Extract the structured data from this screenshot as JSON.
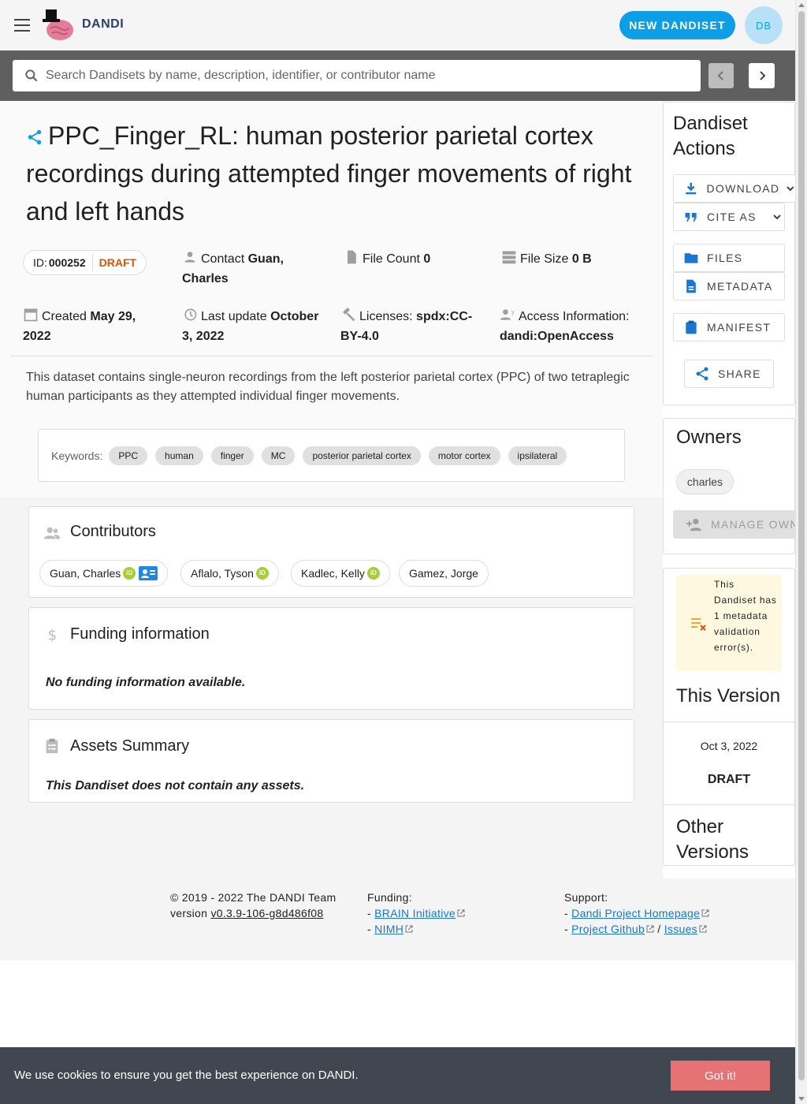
{
  "app": {
    "brand": "DANDI",
    "new_button": "NEW DANDISET",
    "avatar_initials": "DB"
  },
  "search": {
    "placeholder": "Search Dandisets by name, description, identifier, or contributor name"
  },
  "dandiset": {
    "title": "PPC_Finger_RL: human posterior parietal cortex recordings during attempted finger movements of right and left hands",
    "id_label": "ID:",
    "id": "000252",
    "status": "DRAFT",
    "contact_label": "Contact",
    "contact": "Guan, Charles",
    "file_count_label": "File Count",
    "file_count": "0",
    "file_size_label": "File Size",
    "file_size": "0 B",
    "created_label": "Created",
    "created": "May 29, 2022",
    "updated_label": "Last update",
    "updated": "October 3, 2022",
    "licenses_label": "Licenses:",
    "licenses": "spdx:CC-BY-4.0",
    "access_label": "Access Information:",
    "access": "dandi:OpenAccess",
    "description": "This dataset contains single-neuron recordings from the left posterior parietal cortex (PPC) of two tetraplegic human participants as they attempted individual finger movements.",
    "keywords_label": "Keywords:",
    "keywords": [
      "PPC",
      "human",
      "finger",
      "MC",
      "posterior parietal cortex",
      "motor cortex",
      "ipsilateral"
    ]
  },
  "contributors": {
    "title": "Contributors",
    "people": [
      "Guan, Charles",
      "Aflalo, Tyson",
      "Kadlec, Kelly",
      "Gamez, Jorge"
    ],
    "orcid_badge": "iD"
  },
  "funding": {
    "title": "Funding information",
    "empty": "No funding information available."
  },
  "assets": {
    "title": "Assets Summary",
    "empty": "This Dandiset does not contain any assets."
  },
  "actions": {
    "title": "Dandiset Actions",
    "download": "DOWNLOAD",
    "cite": "CITE AS",
    "files": "FILES",
    "metadata": "METADATA",
    "manifest": "MANIFEST",
    "share": "SHARE"
  },
  "owners": {
    "title": "Owners",
    "owner": "charles",
    "manage": "MANAGE OWNERS"
  },
  "validation": {
    "message": "This Dandiset has 1 metadata validation error(s)."
  },
  "version": {
    "title": "This Version",
    "date": "Oct 3, 2022",
    "name": "DRAFT",
    "other_title": "Other Versions"
  },
  "footer": {
    "copyright": "© 2019 - 2022 The DANDI Team",
    "version_label": "version",
    "version": "v0.3.9-106-g8d486f08",
    "funding_label": "Funding:",
    "brain": "BRAIN Initiative",
    "nimh": "NIMH",
    "support_label": "Support:",
    "homepage": "Dandi Project Homepage",
    "github": "Project Github",
    "issues": "Issues",
    "dash": "-",
    "slash": "/"
  },
  "cookie": {
    "message": "We use cookies to ensure you get the best experience on DANDI.",
    "button": "Got it!"
  },
  "colors": {
    "primary": "#0d9ee8",
    "draft": "#e65100",
    "orcid": "#a6ce39",
    "warning_bg": "#fff8e1",
    "cookie_bg": "#414750",
    "cookie_button": "#e57373"
  }
}
